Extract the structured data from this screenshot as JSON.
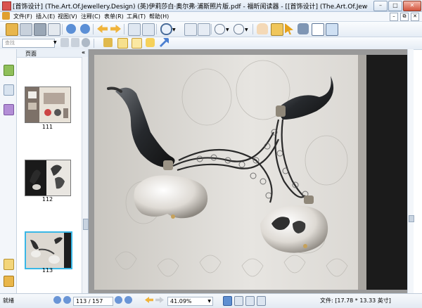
{
  "window": {
    "title": "[首饰设计] (The.Art.Of.Jewellery.Design) (英)伊莉莎白·奥尔弗·浦斯照片版.pdf - 福昕阅读器 - [[首饰设计] (The.Art.Of.Jewellery.Design) (英)伊…",
    "minimize": "–",
    "maximize": "□",
    "close": "✕"
  },
  "menu": {
    "items": [
      "文件(F)",
      "插入(E)",
      "视图(V)",
      "注释(C)",
      "表单(R)",
      "工具(T)",
      "帮助(H)"
    ],
    "mdi_min": "–",
    "mdi_restore": "⧉",
    "mdi_close": "✕"
  },
  "toolbar2": {
    "find_placeholder": "查找"
  },
  "sidebar": {
    "panel_title": "页面",
    "collapse": "«",
    "thumbnails": [
      {
        "label": "111"
      },
      {
        "label": "112"
      },
      {
        "label": "113"
      }
    ]
  },
  "status": {
    "ready": "就绪",
    "page_display": "113 / 157",
    "zoom": "41.09%",
    "file_size": "文件: [17.78 * 13.33 英寸]"
  },
  "icons": {
    "open": "folder-open-icon",
    "save": "save-icon",
    "print": "print-icon",
    "email": "email-icon",
    "hand": "hand-icon",
    "select": "select-icon",
    "zoom_in": "zoom-in-icon"
  }
}
